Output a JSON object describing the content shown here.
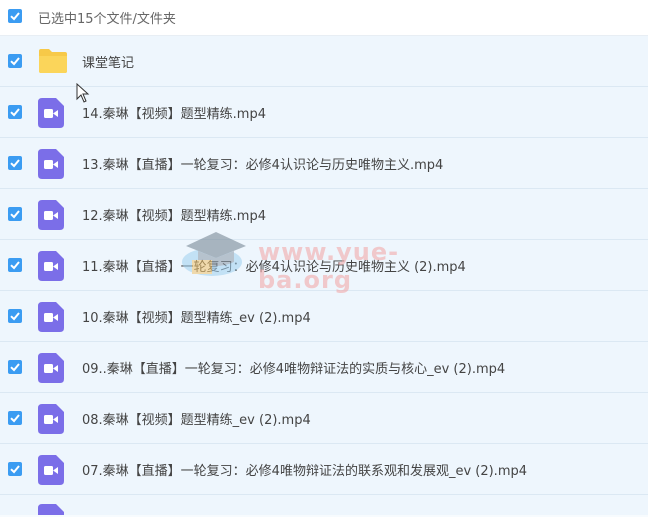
{
  "header": {
    "selection_text": "已选中15个文件/文件夹"
  },
  "watermark": {
    "text": "www.yue-ba.org"
  },
  "colors": {
    "accent": "#3b9cf2",
    "video_icon": "#7b6ee8",
    "folder": "#f7c948"
  },
  "files": [
    {
      "name": "课堂笔记",
      "type": "folder-icon"
    },
    {
      "name": "14.秦琳【视频】题型精练.mp4",
      "type": "video-file-icon"
    },
    {
      "name": "13.秦琳【直播】一轮复习：必修4认识论与历史唯物主义.mp4",
      "type": "video-file-icon"
    },
    {
      "name": "12.秦琳【视频】题型精练.mp4",
      "type": "video-file-icon"
    },
    {
      "name": "11.秦琳【直播】一轮复习：必修4认识论与历史唯物主义 (2).mp4",
      "type": "video-file-icon"
    },
    {
      "name": "10.秦琳【视频】题型精练_ev (2).mp4",
      "type": "video-file-icon"
    },
    {
      "name": "09..秦琳【直播】一轮复习：必修4唯物辩证法的实质与核心_ev (2).mp4",
      "type": "video-file-icon"
    },
    {
      "name": "08.秦琳【视频】题型精练_ev (2).mp4",
      "type": "video-file-icon"
    },
    {
      "name": "07.秦琳【直播】一轮复习：必修4唯物辩证法的联系观和发展观_ev (2).mp4",
      "type": "video-file-icon"
    }
  ]
}
